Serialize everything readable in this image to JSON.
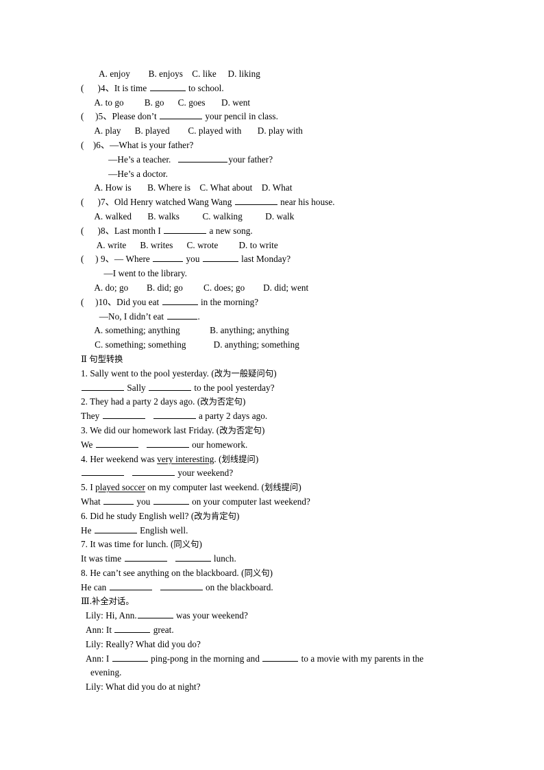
{
  "document": {
    "type": "english-exercise-worksheet",
    "language": "en-zh",
    "page_background": "#ffffff",
    "text_color": "#000000"
  },
  "section_one_tail": {
    "q3_options": "A. enjoy        B. enjoys    C. like     D. liking",
    "questions": [
      {
        "marker": "(      )4、",
        "stem_before": "It is time ",
        "blank": "b-md",
        "stem_after": " to school.",
        "options": "A. to go         B. go      C. goes       D. went"
      },
      {
        "marker": "(     )5、",
        "stem_before": "Please don’t ",
        "blank": "b-lg",
        "stem_after": " your pencil in class.",
        "options": "A. play      B. played        C. played with       D. play with"
      }
    ],
    "q6": {
      "marker": "(    )6、",
      "line1": "—What is your father?",
      "line2_before": "—He’s a teacher.   ",
      "line2_blank": "b-xl",
      "line2_after": "your father?",
      "line3": "—He’s a doctor.",
      "options": "A. How is       B. Where is    C. What about    D. What"
    },
    "q7": {
      "marker": "(      )7、",
      "stem_before": "Old Henry watched Wang Wang ",
      "blank": "b-lg",
      "stem_after": " near his house.",
      "options": "A. walked       B. walks          C. walking          D. walk"
    },
    "q8": {
      "marker": "(      )8、",
      "stem_before": "Last month I ",
      "blank": "b-lg",
      "stem_after": " a new song.",
      "options": "A. write      B. writes      C. wrote         D. to write"
    },
    "q9": {
      "marker": "(     ) 9、",
      "stem_before": "— Where ",
      "blank1": "b-sm",
      "stem_mid": " you ",
      "blank2": "b-md",
      "stem_after": " last Monday?",
      "answer_line": "—I went to the library.",
      "options": "A. do; go        B. did; go         C. does; go        D. did; went"
    },
    "q10": {
      "marker": "(     )10、",
      "stem_before": "Did you eat ",
      "blank": "b-md",
      "stem_after": " in the morning?",
      "answer_before": "—No, I didn’t eat ",
      "answer_blank": "b-sm",
      "answer_after": ".",
      "options_row1": "A. something; anything             B. anything; anything",
      "options_row2": "C. something; something            D. anything; something"
    }
  },
  "section_two": {
    "heading_numeral": "Ⅱ ",
    "heading_cn": "句型转换",
    "items": [
      {
        "prompt_en": "1. Sally went to the pool yesterday. (",
        "prompt_cn": "改为一般疑问句",
        "prompt_tail": ")",
        "answer_pre": "",
        "blank1": "b-lg",
        "answer_mid": " Sally ",
        "blank2": "b-lg",
        "answer_post": " to the pool yesterday?"
      },
      {
        "prompt_en": "2. They had a party 2 days ago. (",
        "prompt_cn": "改为否定句",
        "prompt_tail": ")",
        "answer_pre": "They ",
        "blank1": "b-lg",
        "answer_mid": "   ",
        "blank2": "b-lg",
        "answer_post": " a party 2 days ago."
      },
      {
        "prompt_en": "3. We did our homework last Friday. (",
        "prompt_cn": "改为否定句",
        "prompt_tail": ")",
        "answer_pre": "We ",
        "blank1": "b-lg",
        "answer_mid": "   ",
        "blank2": "b-lg",
        "answer_post": " our homework."
      },
      {
        "prompt_en_a": "4. Her weekend was ",
        "prompt_underlined": "very interesting",
        "prompt_en_b": ". (",
        "prompt_cn": "划线提问",
        "prompt_tail": ")",
        "answer_pre": "",
        "blank1": "b-lg",
        "answer_mid": "   ",
        "blank2": "b-lg",
        "answer_post": " your weekend?"
      },
      {
        "prompt_en_a": "5. I ",
        "prompt_underlined": "played soccer",
        "prompt_en_b": " on my computer last weekend. (",
        "prompt_cn": "划线提问",
        "prompt_tail": ")",
        "answer_pre": "What ",
        "blank1": "b-sm",
        "answer_mid": " you ",
        "blank2": "b-md",
        "answer_post": " on your computer last weekend?"
      },
      {
        "prompt_en": "6. Did he study English well? (",
        "prompt_cn": "改为肯定句",
        "prompt_tail": ")",
        "answer_pre": "He ",
        "blank1": "b-lg",
        "answer_post": " English well."
      },
      {
        "prompt_en": "7. It was time for lunch. (",
        "prompt_cn": "同义句",
        "prompt_tail": ")",
        "answer_pre": "It was time ",
        "blank1": "b-lg",
        "answer_mid": "   ",
        "blank2": "b-md",
        "answer_post": " lunch."
      },
      {
        "prompt_en": "8. He can’t see anything on the blackboard. (",
        "prompt_cn": "同义句",
        "prompt_tail": ")",
        "answer_pre": "He can ",
        "blank1": "b-lg",
        "answer_mid": "   ",
        "blank2": "b-lg",
        "answer_post": " on the blackboard."
      }
    ]
  },
  "section_three": {
    "heading_numeral": "Ⅲ.",
    "heading_cn": "补全对话。",
    "lines": [
      {
        "speaker_text": "Lily: Hi, Ann.",
        "blank": "b-md",
        "tail": " was your weekend?"
      },
      {
        "speaker_text": "Ann: It ",
        "blank": "b-md",
        "tail": " great."
      },
      {
        "speaker_text": "Lily: Really? What did you do?",
        "blank": null,
        "tail": ""
      },
      {
        "speaker_text": "Ann: I ",
        "blank": "b-md",
        "mid": " ping-pong in the morning and ",
        "blank2": "b-md",
        "tail": " to a movie with my parents in the",
        "continuation": "evening."
      },
      {
        "speaker_text": "Lily: What did you do at night?",
        "blank": null,
        "tail": ""
      }
    ]
  }
}
